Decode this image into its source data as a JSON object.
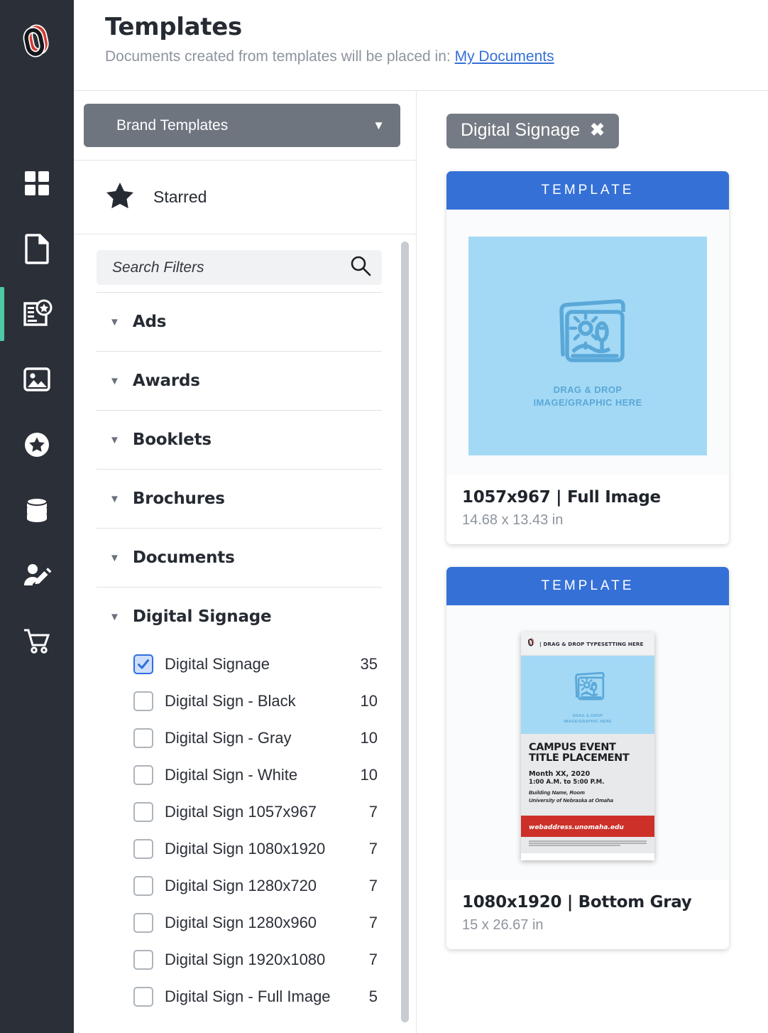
{
  "header": {
    "title": "Templates",
    "subtitle_prefix": "Documents created from templates will be placed in:",
    "destination_link": "My Documents"
  },
  "rail": {
    "logo_name": "uno-logo",
    "items": [
      {
        "icon": "dashboard-grid-icon",
        "active": false
      },
      {
        "icon": "document-icon",
        "active": false
      },
      {
        "icon": "template-star-icon",
        "active": true
      },
      {
        "icon": "image-icon",
        "active": false
      },
      {
        "icon": "star-circle-icon",
        "active": false
      },
      {
        "icon": "database-icon",
        "active": false
      },
      {
        "icon": "user-edit-icon",
        "active": false
      },
      {
        "icon": "shopping-cart-icon",
        "active": false
      }
    ]
  },
  "filter_panel": {
    "brand_select": {
      "label": "Brand Templates",
      "caret": "▼"
    },
    "starred": {
      "label": "Starred",
      "icon": "star-icon"
    },
    "search": {
      "value": "",
      "placeholder": "Search Filters",
      "icon": "search-icon"
    },
    "categories": [
      {
        "name": "Ads",
        "expanded": true,
        "options": []
      },
      {
        "name": "Awards",
        "expanded": true,
        "options": []
      },
      {
        "name": "Booklets",
        "expanded": true,
        "options": []
      },
      {
        "name": "Brochures",
        "expanded": true,
        "options": []
      },
      {
        "name": "Documents",
        "expanded": true,
        "options": []
      },
      {
        "name": "Digital Signage",
        "expanded": true,
        "options": [
          {
            "label": "Digital Signage",
            "count": "35",
            "checked": true
          },
          {
            "label": "Digital Sign - Black",
            "count": "10",
            "checked": false
          },
          {
            "label": "Digital Sign - Gray",
            "count": "10",
            "checked": false
          },
          {
            "label": "Digital Sign - White",
            "count": "10",
            "checked": false
          },
          {
            "label": "Digital Sign 1057x967",
            "count": "7",
            "checked": false
          },
          {
            "label": "Digital Sign 1080x1920",
            "count": "7",
            "checked": false
          },
          {
            "label": "Digital Sign 1280x720",
            "count": "7",
            "checked": false
          },
          {
            "label": "Digital Sign 1280x960",
            "count": "7",
            "checked": false
          },
          {
            "label": "Digital Sign 1920x1080",
            "count": "7",
            "checked": false
          },
          {
            "label": "Digital Sign - Full Image",
            "count": "5",
            "checked": false
          }
        ]
      }
    ]
  },
  "content": {
    "active_filter_chip": {
      "label": "Digital Signage",
      "remove_icon": "close-icon"
    },
    "cards": [
      {
        "band_label": "TEMPLATE",
        "title": "1057x967 | Full Image",
        "dimensions": "14.68 x 13.43 in",
        "preview_type": "full-image",
        "preview": {
          "drag_drop_line1": "DRAG & DROP",
          "drag_drop_line2": "IMAGE/GRAPHIC HERE"
        }
      },
      {
        "band_label": "TEMPLATE",
        "title": "1080x1920 | Bottom Gray",
        "dimensions": "15 x 26.67 in",
        "preview_type": "poster",
        "preview": {
          "typesetting_note": "| DRAG & DROP TYPESETTING HERE",
          "drag_drop_line1": "DRAG & DROP",
          "drag_drop_line2": "IMAGE/GRAPHIC HERE",
          "headline_line1": "CAMPUS EVENT",
          "headline_line2": "TITLE PLACEMENT",
          "date": "Month XX, 2020",
          "time": "1:00 A.M. to 5:00 P.M.",
          "location_line1": "Building Name, Room",
          "location_line2": "University of Nebraska at Omaha",
          "url": "webaddress.unomaha.edu"
        }
      }
    ]
  },
  "colors": {
    "rail_bg": "#2b2f38",
    "rail_active_accent": "#4ec9a5",
    "brand_select_bg": "#6e757f",
    "chip_bg": "#757b84",
    "template_band_blue": "#3570d7",
    "link_blue": "#3570d7",
    "checkbox_blue": "#2f6fe0",
    "placeholder_blue": "#a3d9f5",
    "poster_red": "#cc3029"
  }
}
